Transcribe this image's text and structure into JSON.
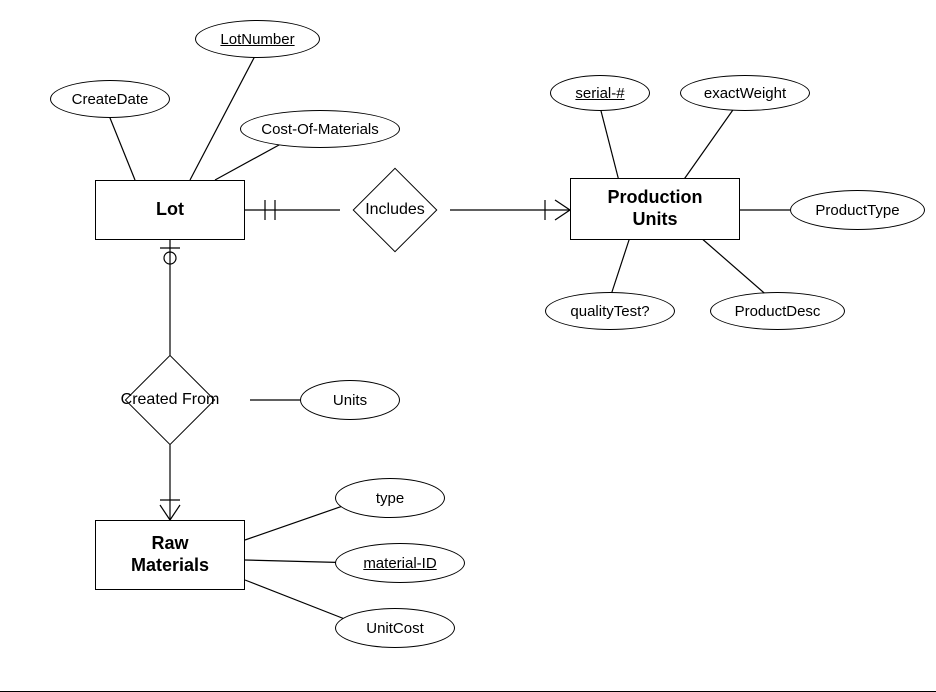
{
  "entities": {
    "lot": "Lot",
    "production_units": "Production\nUnits",
    "raw_materials": "Raw\nMaterials"
  },
  "relationships": {
    "includes": "Includes",
    "created_from": "Created From"
  },
  "attributes": {
    "lot": {
      "create_date": "CreateDate",
      "lot_number": "LotNumber",
      "cost_of_materials": "Cost-Of-Materials"
    },
    "production_units": {
      "serial_no": "serial-#",
      "exact_weight": "exactWeight",
      "product_type": "ProductType",
      "product_desc": "ProductDesc",
      "quality_test": "qualityTest?"
    },
    "raw_materials": {
      "type": "type",
      "material_id": "material-ID",
      "unit_cost": "UnitCost"
    },
    "created_from": {
      "units": "Units"
    }
  },
  "chart_data": {
    "type": "er-diagram",
    "entities": [
      {
        "name": "Lot",
        "attributes": [
          "CreateDate",
          "LotNumber (PK)",
          "Cost-Of-Materials"
        ]
      },
      {
        "name": "Production Units",
        "attributes": [
          "serial-# (PK)",
          "exactWeight",
          "ProductType",
          "ProductDesc",
          "qualityTest?"
        ]
      },
      {
        "name": "Raw Materials",
        "attributes": [
          "type",
          "material-ID (PK)",
          "UnitCost"
        ]
      }
    ],
    "relationships": [
      {
        "name": "Includes",
        "between": [
          "Lot",
          "Production Units"
        ],
        "cardinality": {
          "Lot": "one-and-only-one",
          "Production Units": "one-or-many"
        }
      },
      {
        "name": "Created From",
        "between": [
          "Lot",
          "Raw Materials"
        ],
        "cardinality": {
          "Lot": "zero-or-one",
          "Raw Materials": "one-or-many"
        },
        "attributes": [
          "Units"
        ]
      }
    ]
  }
}
